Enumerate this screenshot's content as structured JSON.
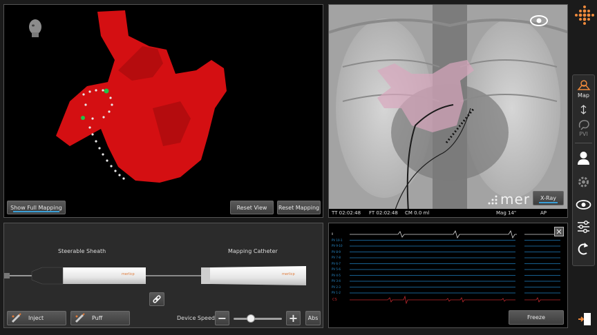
{
  "map_panel": {
    "show_full_mapping": "Show Full Mapping",
    "reset_view": "Reset View",
    "reset_mapping": "Reset Mapping"
  },
  "xray_panel": {
    "logo": "mer",
    "xray_button": "X-Ray",
    "status": {
      "tt": "TT 02:02:48",
      "ft": "FT 02:02:48",
      "cm": "CM 0.0 ml",
      "mag": "Mag 14\"",
      "view": "AP"
    }
  },
  "device_panel": {
    "sheath_label": "Steerable Sheath",
    "catheter_label": "Mapping Catheter",
    "brand": "merlicp",
    "inject": "Inject",
    "puff": "Puff",
    "device_speed": "Device Speed",
    "abs": "Abs",
    "speed_value": 0.35
  },
  "ecg_panel": {
    "channels": [
      "II",
      "PV 10-1",
      "PV 9-10",
      "PV 8-9",
      "PV 7-8",
      "PV 6-7",
      "PV 5-6",
      "PV 4-5",
      "PV 3-4",
      "PV 2-3",
      "PV 1-2"
    ],
    "cs_label": "CS",
    "freeze": "Freeze"
  },
  "sidebar": {
    "map": "Map",
    "pvi": "PVI"
  },
  "colors": {
    "accent": "#3aa0d8",
    "heart": "#d40f12",
    "cs_trace": "#c0282d",
    "logo": "#f08a3c"
  }
}
